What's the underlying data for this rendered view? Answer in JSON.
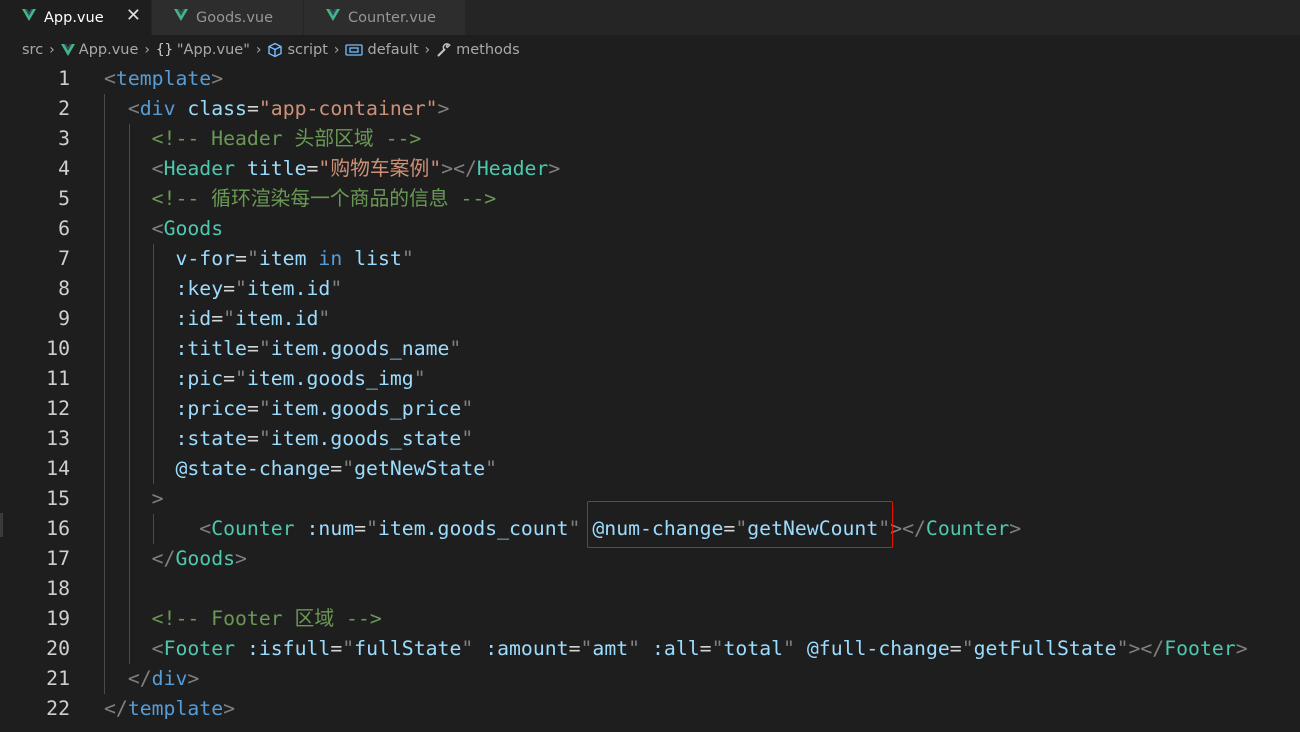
{
  "tabs": [
    {
      "label": "App.vue",
      "active": true,
      "icon": "vue-icon"
    },
    {
      "label": "Goods.vue",
      "active": false,
      "icon": "vue-icon"
    },
    {
      "label": "Counter.vue",
      "active": false,
      "icon": "vue-icon"
    }
  ],
  "tab_close_glyph": "✕",
  "breadcrumb": {
    "items": [
      {
        "label": "src",
        "icon": ""
      },
      {
        "label": "App.vue",
        "icon": "vue-icon"
      },
      {
        "label": "\"App.vue\"",
        "icon": "braces-icon"
      },
      {
        "label": "script",
        "icon": "cube-icon"
      },
      {
        "label": "default",
        "icon": "variable-icon"
      },
      {
        "label": "methods",
        "icon": "wrench-icon"
      }
    ],
    "separator": "›"
  },
  "colors": {
    "background": "#1e1e1e",
    "tag": "#569cd6",
    "component": "#4ec9b0",
    "attribute": "#9cdcfe",
    "string": "#ce9178",
    "comment": "#6a9955",
    "punctuation": "#808080",
    "highlight_border": "#e51400",
    "vue_green": "#41b883"
  },
  "editor": {
    "lines": [
      {
        "n": "1",
        "tokens": [
          [
            "p",
            "<"
          ],
          [
            "tag",
            "template"
          ],
          [
            "p",
            ">"
          ]
        ]
      },
      {
        "n": "2",
        "tokens": [
          [
            "w",
            "  "
          ],
          [
            "p",
            "<"
          ],
          [
            "tag",
            "div"
          ],
          [
            "w",
            " "
          ],
          [
            "attr",
            "class"
          ],
          [
            "w",
            "="
          ],
          [
            "str",
            "\"app-container\""
          ],
          [
            "p",
            ">"
          ]
        ]
      },
      {
        "n": "3",
        "tokens": [
          [
            "w",
            "    "
          ],
          [
            "cmt",
            "<!-- Header 头部区域 -->"
          ]
        ]
      },
      {
        "n": "4",
        "tokens": [
          [
            "w",
            "    "
          ],
          [
            "p",
            "<"
          ],
          [
            "comp",
            "Header"
          ],
          [
            "w",
            " "
          ],
          [
            "attr",
            "title"
          ],
          [
            "w",
            "="
          ],
          [
            "str",
            "\"购物车案例\""
          ],
          [
            "p",
            "></"
          ],
          [
            "comp",
            "Header"
          ],
          [
            "p",
            ">"
          ]
        ]
      },
      {
        "n": "5",
        "tokens": [
          [
            "w",
            "    "
          ],
          [
            "cmt",
            "<!-- 循环渲染每一个商品的信息 -->"
          ]
        ]
      },
      {
        "n": "6",
        "tokens": [
          [
            "w",
            "    "
          ],
          [
            "p",
            "<"
          ],
          [
            "comp",
            "Goods"
          ]
        ]
      },
      {
        "n": "7",
        "tokens": [
          [
            "w",
            "      "
          ],
          [
            "attr",
            "v-for"
          ],
          [
            "w",
            "="
          ],
          [
            "p",
            "\""
          ],
          [
            "attr",
            "item"
          ],
          [
            "w",
            " "
          ],
          [
            "kw",
            "in"
          ],
          [
            "w",
            " "
          ],
          [
            "attr",
            "list"
          ],
          [
            "p",
            "\""
          ]
        ]
      },
      {
        "n": "8",
        "tokens": [
          [
            "w",
            "      "
          ],
          [
            "attr",
            ":key"
          ],
          [
            "w",
            "="
          ],
          [
            "p",
            "\""
          ],
          [
            "attr",
            "item.id"
          ],
          [
            "p",
            "\""
          ]
        ]
      },
      {
        "n": "9",
        "tokens": [
          [
            "w",
            "      "
          ],
          [
            "attr",
            ":id"
          ],
          [
            "w",
            "="
          ],
          [
            "p",
            "\""
          ],
          [
            "attr",
            "item.id"
          ],
          [
            "p",
            "\""
          ]
        ]
      },
      {
        "n": "10",
        "tokens": [
          [
            "w",
            "      "
          ],
          [
            "attr",
            ":title"
          ],
          [
            "w",
            "="
          ],
          [
            "p",
            "\""
          ],
          [
            "attr",
            "item.goods_name"
          ],
          [
            "p",
            "\""
          ]
        ]
      },
      {
        "n": "11",
        "tokens": [
          [
            "w",
            "      "
          ],
          [
            "attr",
            ":pic"
          ],
          [
            "w",
            "="
          ],
          [
            "p",
            "\""
          ],
          [
            "attr",
            "item.goods_img"
          ],
          [
            "p",
            "\""
          ]
        ]
      },
      {
        "n": "12",
        "tokens": [
          [
            "w",
            "      "
          ],
          [
            "attr",
            ":price"
          ],
          [
            "w",
            "="
          ],
          [
            "p",
            "\""
          ],
          [
            "attr",
            "item.goods_price"
          ],
          [
            "p",
            "\""
          ]
        ]
      },
      {
        "n": "13",
        "tokens": [
          [
            "w",
            "      "
          ],
          [
            "attr",
            ":state"
          ],
          [
            "w",
            "="
          ],
          [
            "p",
            "\""
          ],
          [
            "attr",
            "item.goods_state"
          ],
          [
            "p",
            "\""
          ]
        ]
      },
      {
        "n": "14",
        "tokens": [
          [
            "w",
            "      "
          ],
          [
            "attr",
            "@state-change"
          ],
          [
            "w",
            "="
          ],
          [
            "p",
            "\""
          ],
          [
            "attr",
            "getNewState"
          ],
          [
            "p",
            "\""
          ]
        ]
      },
      {
        "n": "15",
        "tokens": [
          [
            "w",
            "    "
          ],
          [
            "p",
            ">"
          ]
        ]
      },
      {
        "n": "16",
        "tokens": [
          [
            "w",
            "        "
          ],
          [
            "p",
            "<"
          ],
          [
            "comp",
            "Counter"
          ],
          [
            "w",
            " "
          ],
          [
            "attr",
            ":num"
          ],
          [
            "w",
            "="
          ],
          [
            "p",
            "\""
          ],
          [
            "attr",
            "item.goods_count"
          ],
          [
            "p",
            "\""
          ],
          [
            "w",
            " "
          ],
          [
            "attr",
            "@num-change"
          ],
          [
            "w",
            "="
          ],
          [
            "p",
            "\""
          ],
          [
            "attr",
            "getNewCount"
          ],
          [
            "p",
            "\""
          ],
          [
            "p",
            "></"
          ],
          [
            "comp",
            "Counter"
          ],
          [
            "p",
            ">"
          ]
        ]
      },
      {
        "n": "17",
        "tokens": [
          [
            "w",
            "    "
          ],
          [
            "p",
            "</"
          ],
          [
            "comp",
            "Goods"
          ],
          [
            "p",
            ">"
          ]
        ]
      },
      {
        "n": "18",
        "tokens": []
      },
      {
        "n": "19",
        "tokens": [
          [
            "w",
            "    "
          ],
          [
            "cmt",
            "<!-- Footer 区域 -->"
          ]
        ]
      },
      {
        "n": "20",
        "tokens": [
          [
            "w",
            "    "
          ],
          [
            "p",
            "<"
          ],
          [
            "comp",
            "Footer"
          ],
          [
            "w",
            " "
          ],
          [
            "attr",
            ":isfull"
          ],
          [
            "w",
            "="
          ],
          [
            "p",
            "\""
          ],
          [
            "attr",
            "fullState"
          ],
          [
            "p",
            "\""
          ],
          [
            "w",
            " "
          ],
          [
            "attr",
            ":amount"
          ],
          [
            "w",
            "="
          ],
          [
            "p",
            "\""
          ],
          [
            "attr",
            "amt"
          ],
          [
            "p",
            "\""
          ],
          [
            "w",
            " "
          ],
          [
            "attr",
            ":all"
          ],
          [
            "w",
            "="
          ],
          [
            "p",
            "\""
          ],
          [
            "attr",
            "total"
          ],
          [
            "p",
            "\""
          ],
          [
            "w",
            " "
          ],
          [
            "attr",
            "@full-change"
          ],
          [
            "w",
            "="
          ],
          [
            "p",
            "\""
          ],
          [
            "attr",
            "getFullState"
          ],
          [
            "p",
            "\""
          ],
          [
            "p",
            "></"
          ],
          [
            "comp",
            "Footer"
          ],
          [
            "p",
            ">"
          ]
        ]
      },
      {
        "n": "21",
        "tokens": [
          [
            "w",
            "  "
          ],
          [
            "p",
            "</"
          ],
          [
            "tag",
            "div"
          ],
          [
            "p",
            ">"
          ]
        ]
      },
      {
        "n": "22",
        "tokens": [
          [
            "p",
            "</"
          ],
          [
            "tag",
            "template"
          ],
          [
            "p",
            ">"
          ]
        ]
      }
    ],
    "highlighted_line": "16",
    "highlighted_text": "@num-change=\"getNewCount\""
  }
}
